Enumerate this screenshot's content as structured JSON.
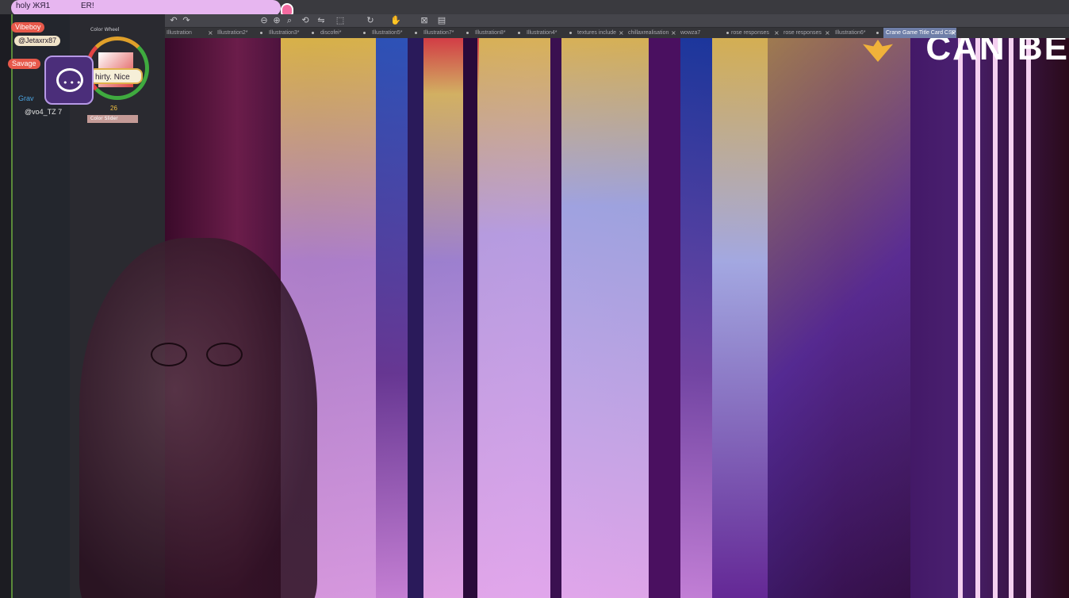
{
  "top_chat": {
    "username": "holy ЖЯ1",
    "message": "ER!"
  },
  "toolbar": {
    "icons": [
      "undo-icon",
      "redo-icon",
      "zoom-out-icon",
      "zoom-in-icon",
      "zoom-fit-icon",
      "rotate-icon",
      "flip-icon",
      "transform-icon",
      "hand-icon",
      "rotate-view-icon",
      "fit-window-icon",
      "layer-icon"
    ]
  },
  "tabs": [
    {
      "label": "Illustration",
      "active": false
    },
    {
      "label": "Illustration2*",
      "active": false
    },
    {
      "label": "Illustration3*",
      "active": false
    },
    {
      "label": "discofei*",
      "active": false
    },
    {
      "label": "Illustration5*",
      "active": false
    },
    {
      "label": "Illustration7*",
      "active": false
    },
    {
      "label": "Illustration8*",
      "active": false
    },
    {
      "label": "Illustration4*",
      "active": false
    },
    {
      "label": "textures include",
      "active": false
    },
    {
      "label": "chillaxrealisation",
      "active": false
    },
    {
      "label": "wowza7",
      "active": false
    },
    {
      "label": "rose responses",
      "active": false
    },
    {
      "label": "rose responses",
      "active": false
    },
    {
      "label": "Illustration6*",
      "active": false
    },
    {
      "label": "Crane Game Title Card CSP",
      "active": true
    }
  ],
  "left_panel": {
    "color_wheel_label": "Color Wheel",
    "color_slider_label": "Color Slider"
  },
  "chat_overlay": {
    "pill1": "Vibeboy",
    "pill2": "@Jetaxrx87",
    "pill3": "Savage",
    "line_red": "Grav",
    "mention": "@vo4_TZ 7",
    "bubble": "hirty. Nice",
    "number": "26"
  },
  "canvas": {
    "logo_text": "CAN BE"
  },
  "colors": {
    "accent": "#6f7fa8",
    "chat_pill": "#e7b6f0",
    "overlay_red": "#e7584a",
    "assistant_bg": "#4b2e7a"
  }
}
